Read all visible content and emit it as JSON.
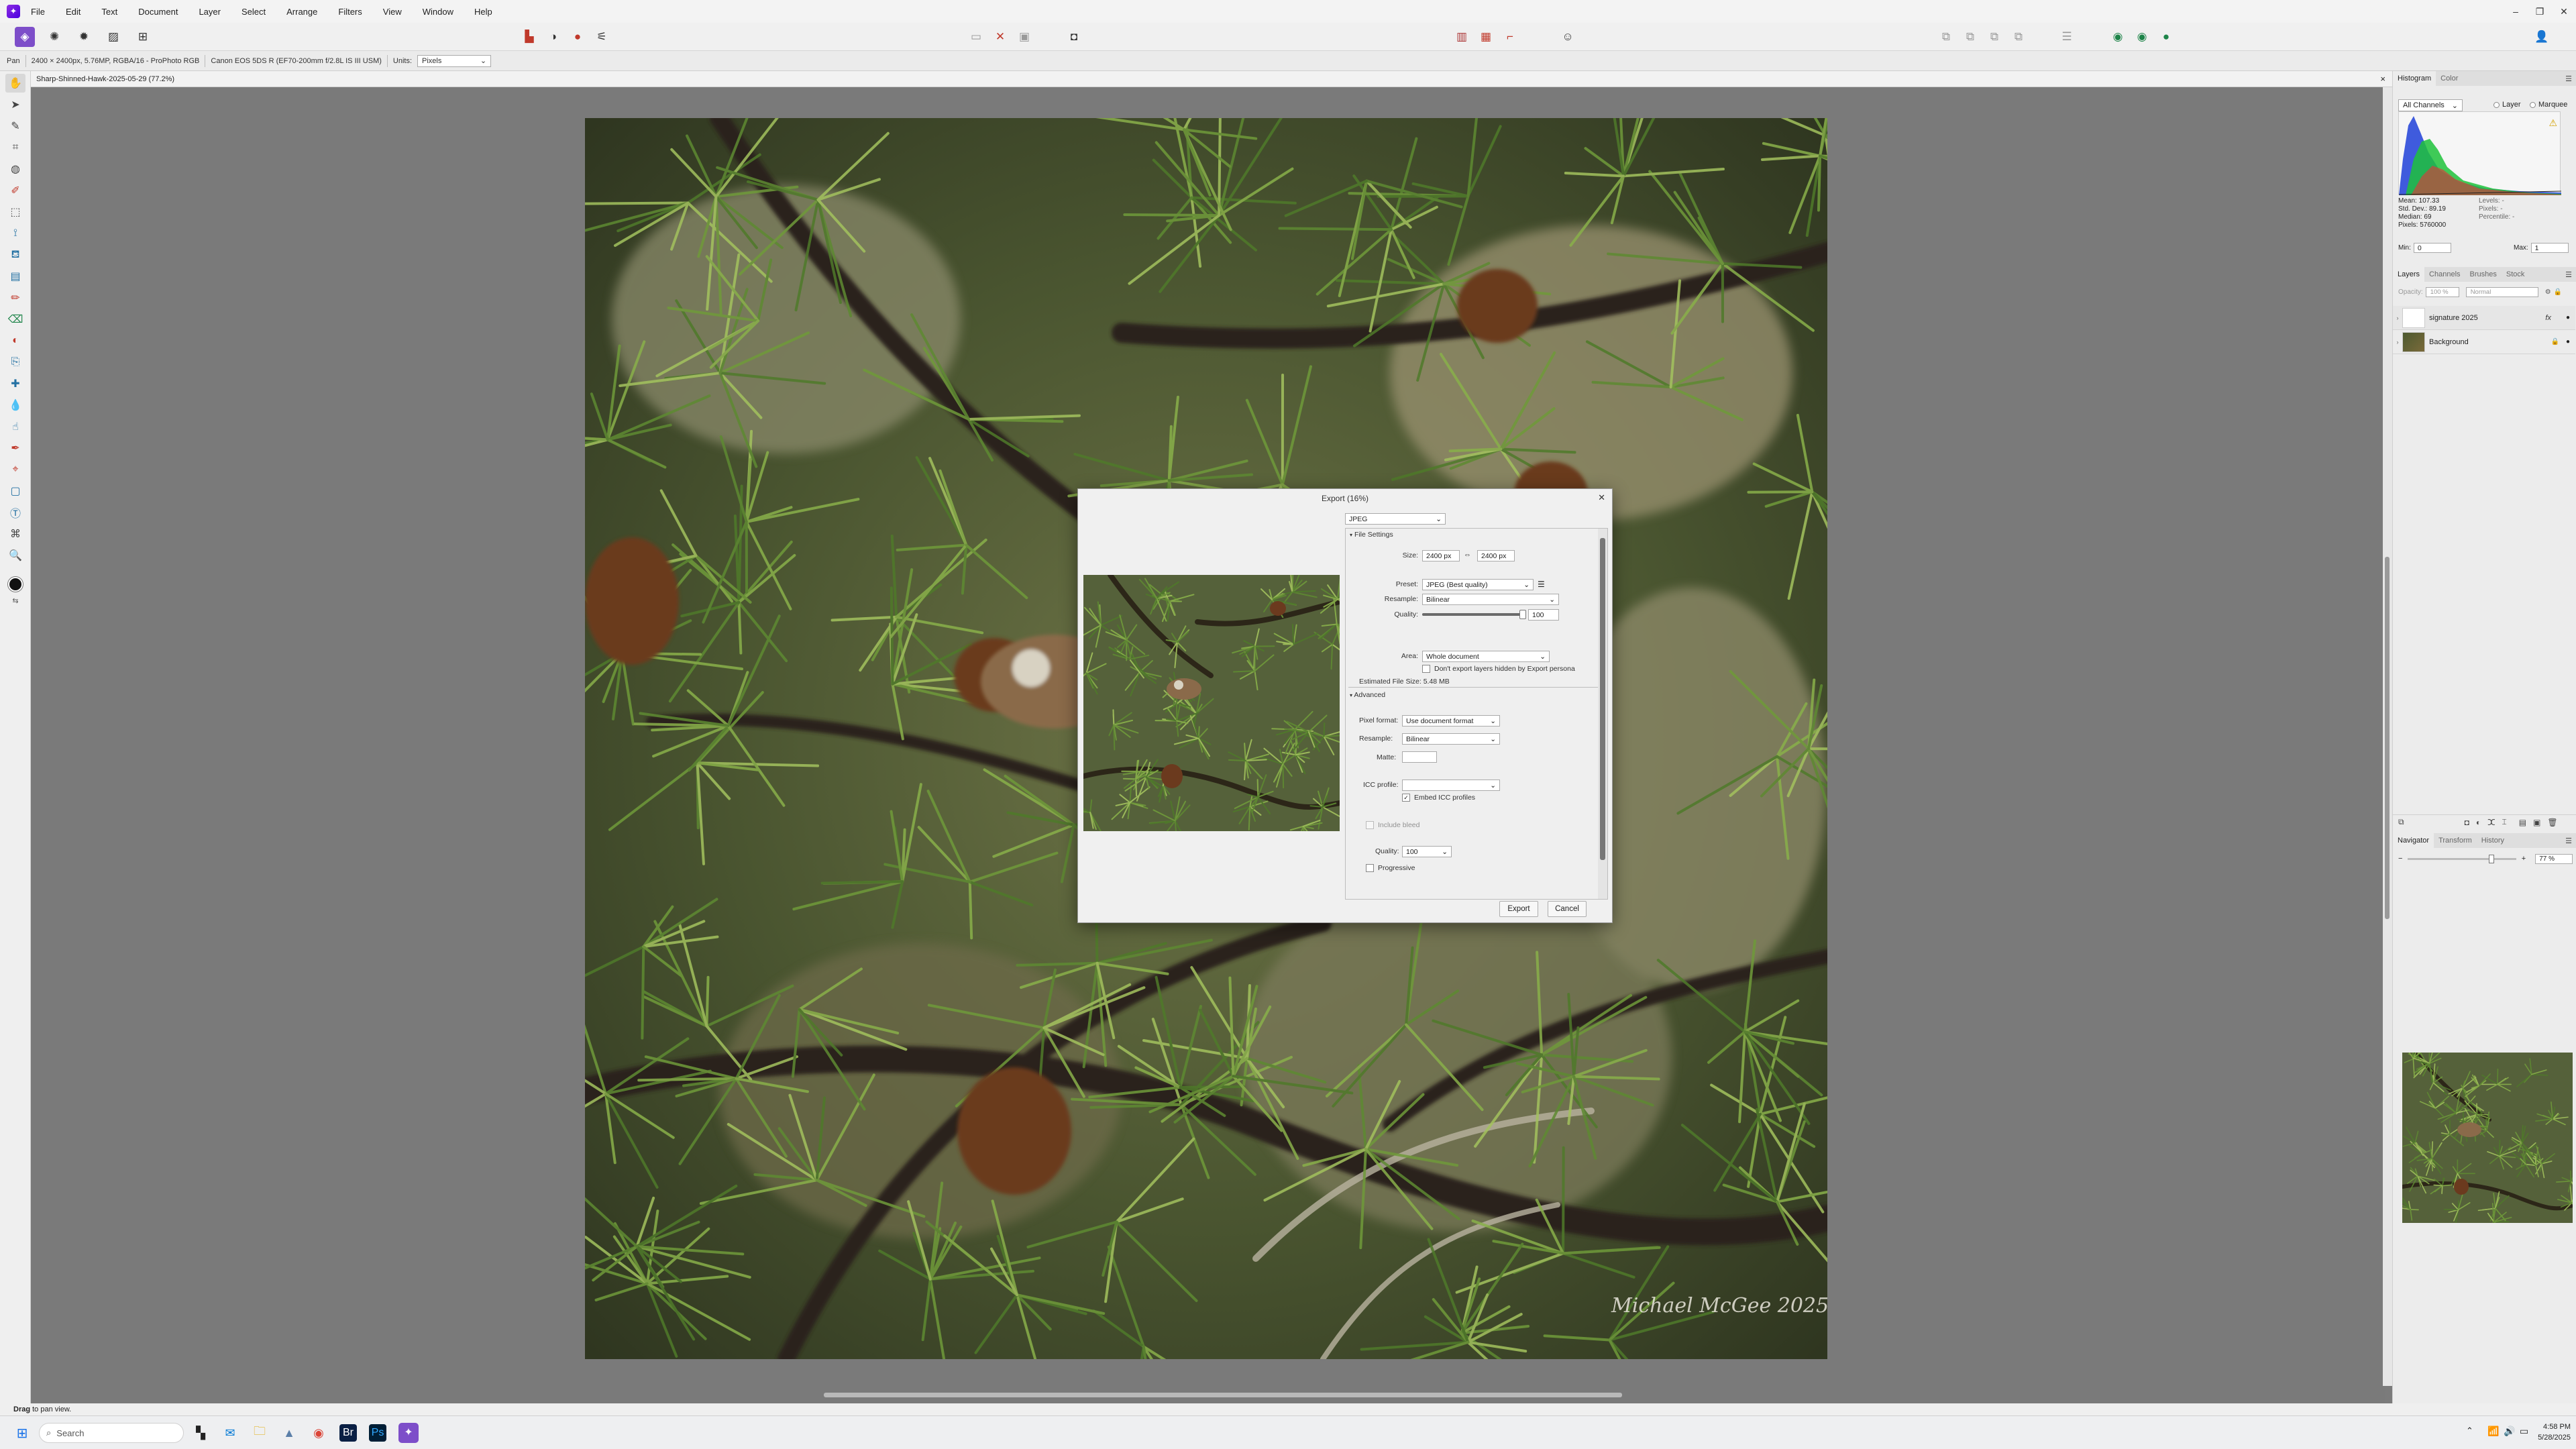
{
  "app": {
    "logo_glyph": "✦",
    "accent": "#7d4ec9"
  },
  "menu": [
    "File",
    "Edit",
    "Text",
    "Document",
    "Layer",
    "Select",
    "Arrange",
    "Filters",
    "View",
    "Window",
    "Help"
  ],
  "context_bar": {
    "tool": "Pan",
    "doc_info": "2400 × 2400px, 5.76MP, RGBA/16 - ProPhoto RGB",
    "camera": "Canon EOS 5DS R (EF70-200mm f/2.8L IS III USM)",
    "units_label": "Units:",
    "units_value": "Pixels"
  },
  "doc_tab": {
    "title": "Sharp-Shinned-Hawk-2025-05-29 (77.2%)",
    "close": "×"
  },
  "watermark": "Michael McGee 2025",
  "status": {
    "bold": "Drag",
    "text": "to pan view."
  },
  "taskbar": {
    "search_placeholder": "Search",
    "time": "4:58 PM",
    "date": "5/28/2025"
  },
  "histogram": {
    "tabs": [
      "Histogram",
      "Color"
    ],
    "channel": "All Channels",
    "layer_opt": "Layer",
    "marquee_opt": "Marquee",
    "stats": [
      "Mean: 107.33",
      "Std. Dev.: 89.19",
      "Median: 69",
      "Pixels: 5760000"
    ],
    "stats_right": [
      "Levels: -",
      "Pixels: -",
      "Percentile: -"
    ],
    "min_label": "Min:",
    "min_value": "0",
    "max_label": "Max:",
    "max_value": "1"
  },
  "layers": {
    "tabs": [
      "Layers",
      "Channels",
      "Brushes",
      "Stock"
    ],
    "opacity": "100 %",
    "blend": "Normal",
    "opacity_label": "Opacity:",
    "items": [
      {
        "name": "signature 2025",
        "fx": "fx"
      },
      {
        "name": "Background",
        "fx": ""
      }
    ]
  },
  "navigator": {
    "tabs": [
      "Navigator",
      "Transform",
      "History"
    ],
    "zoom": "77 %",
    "zoom_fraction": 0.77
  },
  "export": {
    "title": "Export (16%)",
    "format": "JPEG",
    "file_settings": "File Settings",
    "size_label": "Size:",
    "width": "2400 px",
    "height": "2400 px",
    "preset_label": "Preset:",
    "preset": "JPEG (Best quality)",
    "resample_label": "Resample:",
    "resample": "Bilinear",
    "quality_label": "Quality:",
    "quality": "100",
    "quality_fraction": 1.0,
    "area_label": "Area:",
    "area": "Whole document",
    "hidden_layers": "Don't export layers hidden by Export persona",
    "filesize": "Estimated File Size: 5.48 MB",
    "advanced": "Advanced",
    "pixel_format_label": "Pixel format:",
    "pixel_format": "Use document format",
    "resample2_label": "Resample:",
    "resample2": "Bilinear",
    "matte_label": "Matte:",
    "icc_label": "ICC profile:",
    "icc": "",
    "embed_icc": "Embed ICC profiles",
    "include_bleed": "Include bleed",
    "quality2_label": "Quality:",
    "quality2": "100",
    "progressive": "Progressive",
    "export_btn": "Export",
    "cancel_btn": "Cancel"
  }
}
